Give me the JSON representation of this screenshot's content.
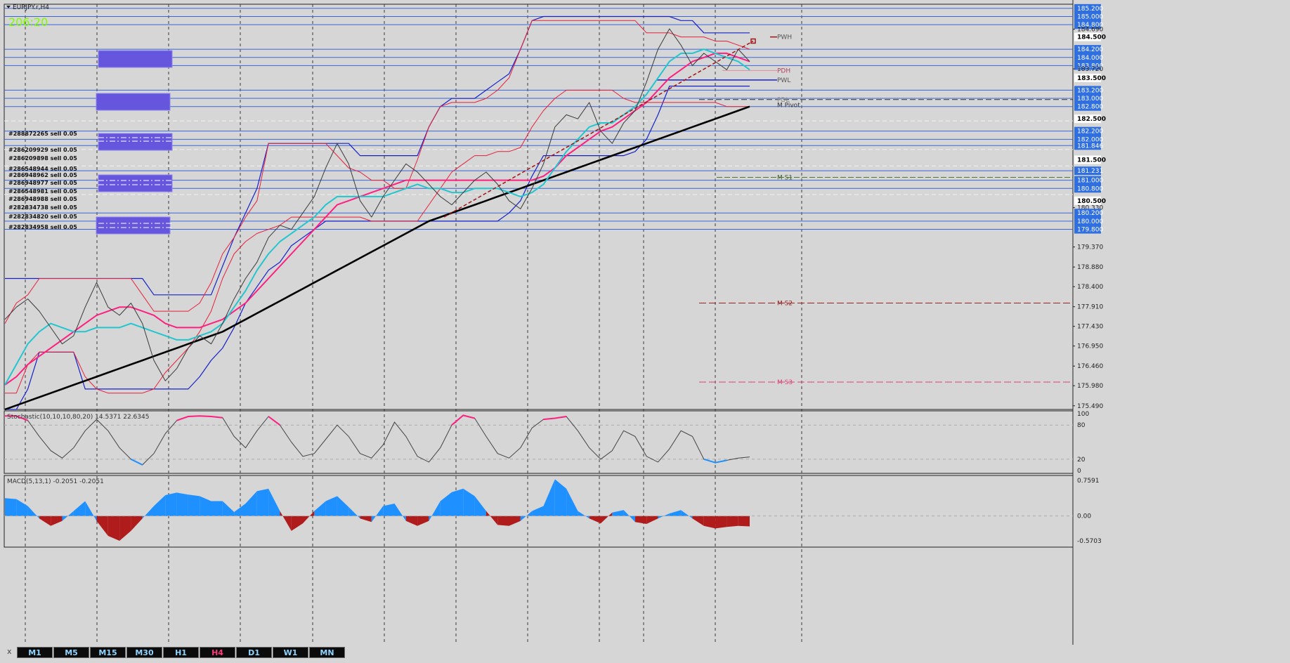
{
  "chart_title": "EURJPY.r,H4",
  "countdown": "206:20",
  "colors": {
    "background": "#d6d6d6",
    "grid": "#3a3a3a",
    "price": "#3a3a3a",
    "channel_red": "#e8203a",
    "channel_blue": "#1622c8",
    "ema_cyan": "#22c6cf",
    "ema_pink": "#ff1f80",
    "ma_black": "#000000",
    "order_block": "#6655dd",
    "macd_pos": "#1e90ff",
    "macd_neg": "#b01c1c",
    "stoch_high": "#ff1f80",
    "stoch_low": "#1e90ff",
    "level_blue": "#3b66d9",
    "trend_red": "#a01414",
    "countdown": "#7fff00"
  },
  "main_axis": {
    "labels": [
      {
        "v": 185.2,
        "t": "185.200",
        "style": "blue"
      },
      {
        "v": 185.0,
        "t": "185.000",
        "style": "blue"
      },
      {
        "v": 184.8,
        "t": "184.800",
        "style": "blue"
      },
      {
        "v": 184.69,
        "t": "184.690",
        "style": "plain"
      },
      {
        "v": 184.5,
        "t": "184.500",
        "style": "black"
      },
      {
        "v": 184.2,
        "t": "184.200",
        "style": "blue"
      },
      {
        "v": 184.0,
        "t": "184.000",
        "style": "blue"
      },
      {
        "v": 183.8,
        "t": "183.800",
        "style": "blue"
      },
      {
        "v": 183.72,
        "t": "183.720",
        "style": "plain"
      },
      {
        "v": 183.5,
        "t": "183.500",
        "style": "black"
      },
      {
        "v": 183.2,
        "t": "183.200",
        "style": "blue"
      },
      {
        "v": 183.0,
        "t": "183.000",
        "style": "blue"
      },
      {
        "v": 182.8,
        "t": "182.800",
        "style": "blue"
      },
      {
        "v": 182.5,
        "t": "182.500",
        "style": "black"
      },
      {
        "v": 182.2,
        "t": "182.200",
        "style": "blue"
      },
      {
        "v": 182.0,
        "t": "182.000",
        "style": "blue"
      },
      {
        "v": 181.846,
        "t": "181.846",
        "style": "blue"
      },
      {
        "v": 181.5,
        "t": "181.500",
        "style": "black"
      },
      {
        "v": 181.231,
        "t": "181.231",
        "style": "blue"
      },
      {
        "v": 181.0,
        "t": "181.000",
        "style": "blue"
      },
      {
        "v": 180.8,
        "t": "180.800",
        "style": "blue"
      },
      {
        "v": 180.5,
        "t": "180.500",
        "style": "black"
      },
      {
        "v": 180.33,
        "t": "180.330",
        "style": "plain"
      },
      {
        "v": 180.2,
        "t": "180.200",
        "style": "blue"
      },
      {
        "v": 180.0,
        "t": "180.000",
        "style": "blue"
      },
      {
        "v": 179.8,
        "t": "179.800",
        "style": "blue"
      },
      {
        "v": 179.37,
        "t": "179.370",
        "style": "plain"
      },
      {
        "v": 178.88,
        "t": "178.880",
        "style": "plain"
      },
      {
        "v": 178.4,
        "t": "178.400",
        "style": "plain"
      },
      {
        "v": 177.91,
        "t": "177.910",
        "style": "plain"
      },
      {
        "v": 177.43,
        "t": "177.430",
        "style": "plain"
      },
      {
        "v": 176.95,
        "t": "176.950",
        "style": "plain"
      },
      {
        "v": 176.46,
        "t": "176.460",
        "style": "plain"
      },
      {
        "v": 175.98,
        "t": "175.980",
        "style": "plain"
      },
      {
        "v": 175.49,
        "t": "175.490",
        "style": "plain"
      }
    ]
  },
  "pivot_labels": [
    {
      "t": "PWH",
      "v": 184.5,
      "color": "#555555"
    },
    {
      "t": "PDH",
      "v": 183.68,
      "color": "#b04060"
    },
    {
      "t": "PWL",
      "v": 183.45,
      "color": "#555555"
    },
    {
      "t": "PDL",
      "v": 182.97,
      "color": "#888888"
    },
    {
      "t": "M Pivot",
      "v": 182.84,
      "color": "#333333"
    },
    {
      "t": "M S1",
      "v": 181.07,
      "color": "#406030"
    },
    {
      "t": "M S2",
      "v": 178.0,
      "color": "#9a2020"
    },
    {
      "t": "M S3",
      "v": 176.07,
      "color": "#e0407a"
    }
  ],
  "orders": [
    "#288872265 sell 0.05",
    "#286209929 sell 0.05",
    "#286209898 sell 0.05",
    "#286548944 sell 0.05",
    "#286948962 sell 0.05",
    "#286948977 sell 0.05",
    "#286548981 sell 0.05",
    "#286948988 sell 0.05",
    "#282834738 sell 0.05",
    "#282834820 sell 0.05",
    "#282834958 sell 0.05"
  ],
  "stoch": {
    "label": "Stochastic(10,10,10,80,20) 14.5371 22.6345",
    "ticks": [
      "100",
      "80",
      "20",
      "0"
    ]
  },
  "macd": {
    "label": "MACD(5,13,1) -0.2051 -0.2051",
    "ticks": [
      "0.7591",
      "0.00",
      "-0.5703"
    ]
  },
  "timeframes": [
    "M1",
    "M5",
    "M15",
    "M30",
    "H1",
    "H4",
    "D1",
    "W1",
    "MN"
  ],
  "active_timeframe": "H4",
  "close_glyph": "x",
  "chart_data": {
    "type": "line",
    "symbol": "EURJPY",
    "timeframe": "H4",
    "ylim": [
      175.4,
      185.3
    ],
    "x": [
      0,
      5,
      10,
      15,
      20,
      25,
      30,
      35,
      40,
      45,
      50,
      55,
      60,
      65,
      70,
      75,
      80,
      85,
      90,
      95,
      100,
      105,
      110,
      115,
      120,
      125,
      130,
      135,
      140,
      145,
      150,
      155,
      160,
      165,
      170,
      175,
      180,
      185,
      190,
      195,
      200,
      205,
      210,
      215,
      220,
      225,
      230,
      235,
      240,
      245,
      250,
      255,
      260,
      265,
      270,
      275,
      280,
      285,
      290,
      295,
      300,
      305,
      310,
      315,
      320,
      325
    ],
    "series": [
      {
        "key": "price",
        "values": [
          177.6,
          177.9,
          178.1,
          177.8,
          177.4,
          177.0,
          177.2,
          177.9,
          178.5,
          177.9,
          177.7,
          178.0,
          177.5,
          176.6,
          176.1,
          176.4,
          176.9,
          177.2,
          177.0,
          177.5,
          178.1,
          178.6,
          179.0,
          179.6,
          179.9,
          179.8,
          180.2,
          180.6,
          181.3,
          181.9,
          181.4,
          180.5,
          180.1,
          180.6,
          181.0,
          181.4,
          181.2,
          180.9,
          180.6,
          180.4,
          180.7,
          181.0,
          181.2,
          180.9,
          180.5,
          180.3,
          180.8,
          181.4,
          182.3,
          182.6,
          182.5,
          182.9,
          182.2,
          181.9,
          182.4,
          182.7,
          183.4,
          184.2,
          184.7,
          184.3,
          183.8,
          184.1,
          183.9,
          183.7,
          184.2,
          183.9
        ]
      },
      {
        "key": "ema_fast",
        "values": [
          176.0,
          176.5,
          177.0,
          177.3,
          177.5,
          177.4,
          177.3,
          177.3,
          177.4,
          177.4,
          177.4,
          177.5,
          177.4,
          177.3,
          177.2,
          177.1,
          177.1,
          177.2,
          177.3,
          177.5,
          177.9,
          178.3,
          178.8,
          179.2,
          179.5,
          179.7,
          179.9,
          180.1,
          180.4,
          180.6,
          180.6,
          180.6,
          180.6,
          180.6,
          180.7,
          180.8,
          180.9,
          180.8,
          180.8,
          180.7,
          180.7,
          180.8,
          180.8,
          180.8,
          180.7,
          180.6,
          180.7,
          180.9,
          181.3,
          181.7,
          182.0,
          182.3,
          182.4,
          182.4,
          182.6,
          182.8,
          183.1,
          183.5,
          183.9,
          184.1,
          184.1,
          184.2,
          184.1,
          184.0,
          183.9,
          183.7
        ]
      },
      {
        "key": "ema_slow",
        "values": [
          176.0,
          176.2,
          176.5,
          176.7,
          176.9,
          177.1,
          177.3,
          177.5,
          177.7,
          177.8,
          177.9,
          177.9,
          177.8,
          177.7,
          177.5,
          177.4,
          177.4,
          177.4,
          177.5,
          177.6,
          177.8,
          178.0,
          178.3,
          178.6,
          178.9,
          179.2,
          179.5,
          179.8,
          180.1,
          180.4,
          180.5,
          180.6,
          180.7,
          180.8,
          180.9,
          181.0,
          181.0,
          181.0,
          181.0,
          181.0,
          181.0,
          181.0,
          181.0,
          181.0,
          181.0,
          181.0,
          181.0,
          181.1,
          181.3,
          181.6,
          181.8,
          182.0,
          182.2,
          182.3,
          182.5,
          182.7,
          182.9,
          183.2,
          183.5,
          183.7,
          183.9,
          184.0,
          184.1,
          184.1,
          184.0,
          183.9
        ]
      },
      {
        "key": "ma_long",
        "values": [
          175.4,
          175.5,
          175.6,
          175.7,
          175.8,
          175.9,
          176.0,
          176.1,
          176.2,
          176.3,
          176.4,
          176.5,
          176.6,
          176.7,
          176.8,
          176.9,
          177.0,
          177.1,
          177.2,
          177.3,
          177.45,
          177.6,
          177.75,
          177.9,
          178.05,
          178.2,
          178.35,
          178.5,
          178.65,
          178.8,
          178.95,
          179.1,
          179.25,
          179.4,
          179.55,
          179.7,
          179.85,
          180.0,
          180.1,
          180.2,
          180.3,
          180.4,
          180.5,
          180.6,
          180.7,
          180.8,
          180.9,
          181.0,
          181.1,
          181.2,
          181.3,
          181.4,
          181.5,
          181.6,
          181.7,
          181.8,
          181.9,
          182.0,
          182.1,
          182.2,
          182.3,
          182.4,
          182.5,
          182.6,
          182.7,
          182.8
        ]
      },
      {
        "key": "ch_red_upper",
        "values": [
          177.5,
          178.0,
          178.2,
          178.6,
          178.6,
          178.6,
          178.6,
          178.6,
          178.6,
          178.6,
          178.6,
          178.6,
          178.2,
          177.8,
          177.8,
          177.8,
          177.8,
          178.0,
          178.5,
          179.2,
          179.6,
          180.1,
          180.5,
          181.9,
          181.9,
          181.9,
          181.9,
          181.9,
          181.9,
          181.6,
          181.3,
          181.2,
          181.0,
          181.0,
          180.8,
          180.8,
          181.5,
          182.3,
          182.8,
          182.9,
          182.9,
          182.9,
          183.0,
          183.2,
          183.5,
          184.2,
          184.9,
          184.9,
          184.9,
          184.9,
          184.9,
          184.9,
          184.9,
          184.9,
          184.9,
          184.9,
          184.6,
          184.6,
          184.6,
          184.5,
          184.5,
          184.5,
          184.4,
          184.4,
          184.3,
          184.2
        ]
      },
      {
        "key": "ch_red_lower",
        "values": [
          175.8,
          175.8,
          176.5,
          176.8,
          176.8,
          176.8,
          176.8,
          176.2,
          175.9,
          175.8,
          175.8,
          175.8,
          175.8,
          175.9,
          176.3,
          176.6,
          176.9,
          177.3,
          177.8,
          178.6,
          179.2,
          179.5,
          179.7,
          179.8,
          179.9,
          180.1,
          180.1,
          180.1,
          180.1,
          180.1,
          180.1,
          180.1,
          180.0,
          180.0,
          180.0,
          180.0,
          180.0,
          180.4,
          180.8,
          181.2,
          181.4,
          181.6,
          181.6,
          181.7,
          181.7,
          181.8,
          182.3,
          182.7,
          183.0,
          183.2,
          183.2,
          183.2,
          183.2,
          183.2,
          183.0,
          182.9,
          182.9,
          182.9,
          182.9,
          182.9,
          182.9,
          182.9,
          182.9,
          182.8,
          182.8,
          182.8
        ]
      },
      {
        "key": "ch_blue_upper",
        "values": [
          178.6,
          178.6,
          178.6,
          178.6,
          178.6,
          178.6,
          178.6,
          178.6,
          178.6,
          178.6,
          178.6,
          178.6,
          178.6,
          178.2,
          178.2,
          178.2,
          178.2,
          178.2,
          178.2,
          178.9,
          179.6,
          180.2,
          180.8,
          181.9,
          181.9,
          181.9,
          181.9,
          181.9,
          181.9,
          181.9,
          181.9,
          181.6,
          181.6,
          181.6,
          181.6,
          181.6,
          181.6,
          182.3,
          182.8,
          183.0,
          183.0,
          183.0,
          183.2,
          183.4,
          183.6,
          184.2,
          184.9,
          185.0,
          185.0,
          185.0,
          185.0,
          185.0,
          185.0,
          185.0,
          185.0,
          185.0,
          185.0,
          185.0,
          185.0,
          184.9,
          184.9,
          184.6,
          184.6,
          184.6,
          184.6,
          184.6
        ]
      },
      {
        "key": "ch_blue_lower",
        "values": [
          175.4,
          175.4,
          175.9,
          176.8,
          176.8,
          176.8,
          176.8,
          175.9,
          175.9,
          175.9,
          175.9,
          175.9,
          175.9,
          175.9,
          175.9,
          175.9,
          175.9,
          176.2,
          176.6,
          176.9,
          177.4,
          178.0,
          178.4,
          178.8,
          179.0,
          179.4,
          179.6,
          179.8,
          180.0,
          180.0,
          180.0,
          180.0,
          180.0,
          180.0,
          180.0,
          180.0,
          180.0,
          180.0,
          180.0,
          180.0,
          180.0,
          180.0,
          180.0,
          180.0,
          180.2,
          180.5,
          181.1,
          181.6,
          181.6,
          181.6,
          181.6,
          181.6,
          181.6,
          181.6,
          181.6,
          181.7,
          182.0,
          182.6,
          183.3,
          183.3,
          183.3,
          183.3,
          183.3,
          183.3,
          183.3,
          183.3
        ]
      }
    ]
  }
}
